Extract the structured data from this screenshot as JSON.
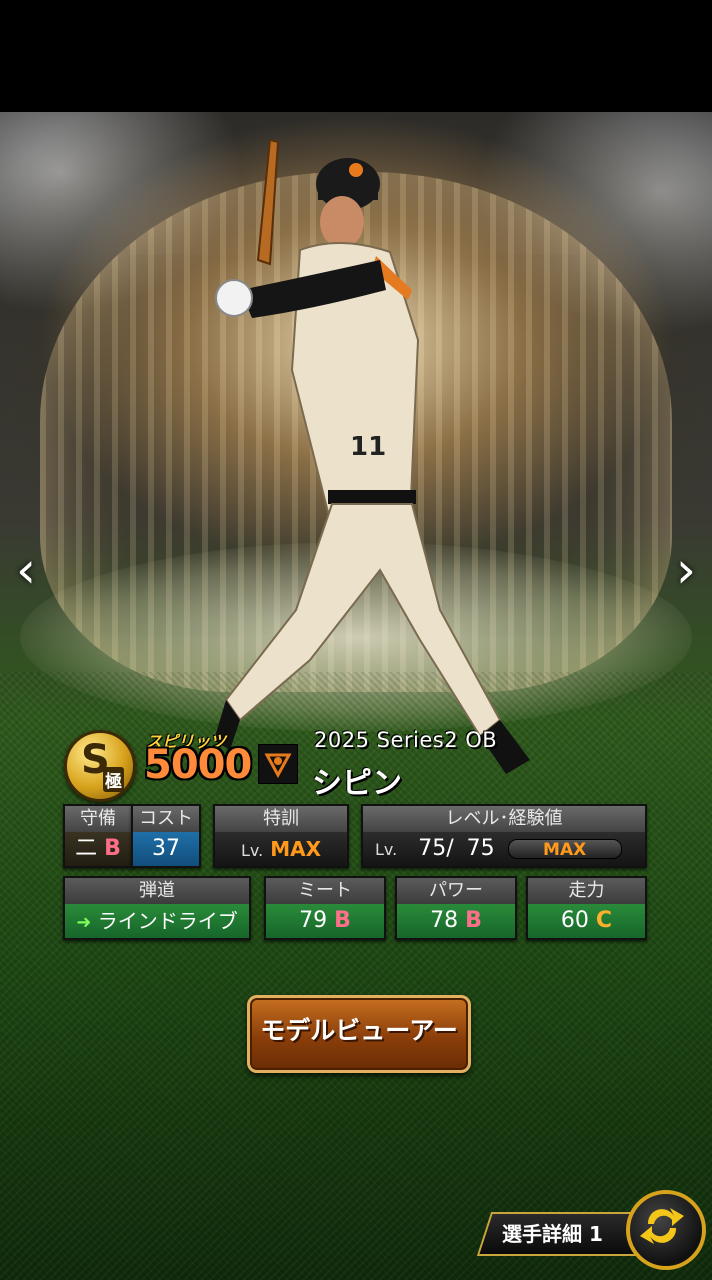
{
  "card": {
    "rank_letter": "S",
    "rank_sub": "極",
    "spirits_label": "スピリッツ",
    "spirits_value": "5000",
    "series": "2025 Series2 OB",
    "player_name": "シピン"
  },
  "stats": {
    "defense": {
      "header": "守備",
      "position": "二",
      "grade": "B"
    },
    "cost": {
      "header": "コスト",
      "value": "37"
    },
    "special_training": {
      "header": "特訓",
      "lv_prefix": "Lv.",
      "value": "MAX"
    },
    "level": {
      "header": "レベル･経験値",
      "lv_prefix": "Lv.",
      "current": "75/",
      "max": "75",
      "exp_label": "MAX"
    },
    "trajectory": {
      "header": "弾道",
      "value": "ラインドライブ"
    },
    "contact": {
      "header": "ミート",
      "value": "79",
      "grade": "B"
    },
    "power": {
      "header": "パワー",
      "value": "78",
      "grade": "B"
    },
    "speed": {
      "header": "走力",
      "value": "60",
      "grade": "C"
    }
  },
  "buttons": {
    "model_viewer": "モデルビューアー",
    "player_detail": "選手詳細 1"
  },
  "nav": {
    "prev": "‹",
    "next": "›"
  },
  "colors": {
    "accent_orange": "#ff8a3a",
    "grade_b": "#ff6f8a",
    "grade_c": "#ffb02a",
    "stat_green": "#2a8b3a"
  }
}
